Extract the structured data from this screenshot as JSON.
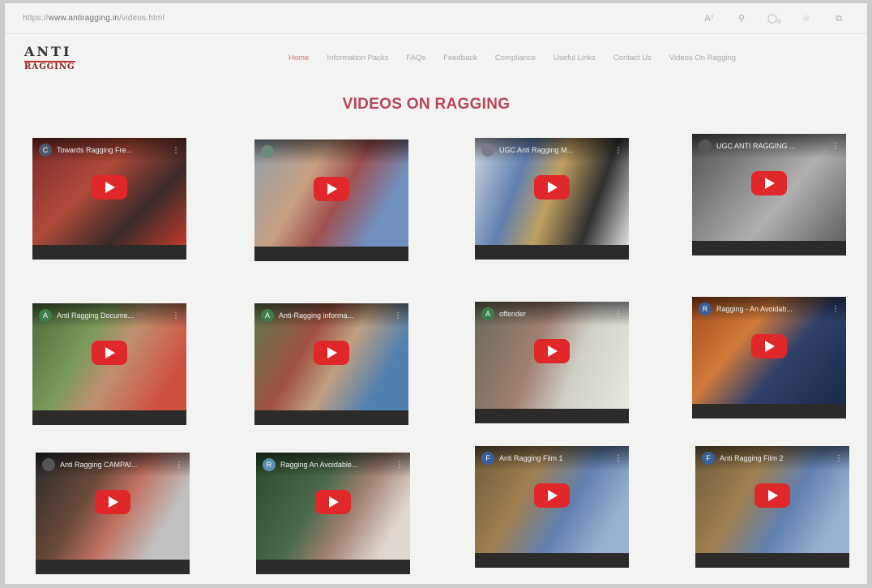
{
  "browser": {
    "url_scheme": "https://",
    "url_host": "www.antiragging.in",
    "url_path": "/videos.html",
    "icons": [
      "read-aloud-icon",
      "zoom-icon",
      "tracking-icon",
      "favorite-icon",
      "collections-icon"
    ],
    "tracking_count": "0"
  },
  "logo": {
    "line1": "ANTI",
    "line2": "RAGGING"
  },
  "nav": {
    "items": [
      "Home",
      "Information Packs",
      "FAQs",
      "Feedback",
      "Compliance",
      "Useful Links",
      "Contact Us",
      "Videos On Ragging"
    ],
    "active_index": 0
  },
  "page": {
    "title": "VIDEOS ON RAGGING"
  },
  "videos": [
    {
      "channel": "C",
      "title": "Towards Ragging Fre...",
      "channel_color": "#4a5a6a"
    },
    {
      "channel": "",
      "title": "",
      "channel_color": "#6a8a7a"
    },
    {
      "channel": "",
      "title": "UGC Anti Ragging M...",
      "channel_color": "#7a7a8a"
    },
    {
      "channel": "",
      "title": "UGC ANTI RAGGING ...",
      "channel_color": "#555555"
    },
    {
      "channel": "A",
      "title": "Anti Ragging Docume...",
      "channel_color": "#3f7d4a"
    },
    {
      "channel": "A",
      "title": "Anti-Ragging informa...",
      "channel_color": "#3f7d4a"
    },
    {
      "channel": "A",
      "title": "offender",
      "channel_color": "#3f7d4a"
    },
    {
      "channel": "R",
      "title": "Ragging - An Avoidab...",
      "channel_color": "#3a5f9c"
    },
    {
      "channel": "",
      "title": "Anti Ragging CAMPAI...",
      "channel_color": "#555555"
    },
    {
      "channel": "R",
      "title": "Ragging An Avoidable...",
      "channel_color": "#5b8fb0"
    },
    {
      "channel": "F",
      "title": "Anti Ragging Film 1",
      "channel_color": "#3a5f9c"
    },
    {
      "channel": "F",
      "title": "Anti Ragging Film 2",
      "channel_color": "#3a5f9c"
    }
  ]
}
